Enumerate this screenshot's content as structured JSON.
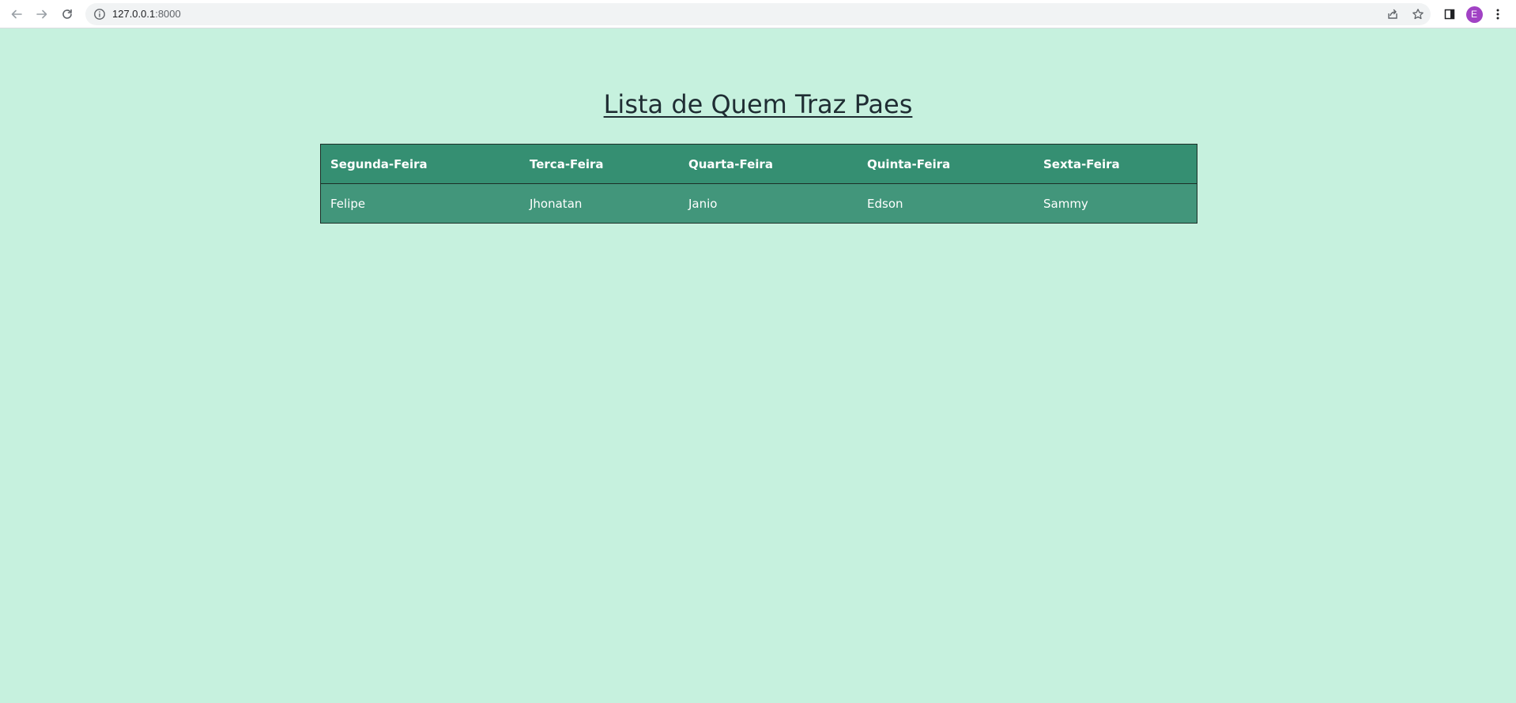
{
  "browser": {
    "url_host": "127.0.0.1",
    "url_port": ":8000",
    "profile_initial": "E",
    "icons": {
      "back": "arrow-left-icon",
      "forward": "arrow-right-icon",
      "reload": "reload-icon",
      "site_info": "info-icon",
      "share": "share-icon",
      "bookmark": "star-icon",
      "side_panel": "side-panel-icon",
      "menu": "kebab-menu-icon"
    }
  },
  "page": {
    "title": "Lista de Quem Traz Paes",
    "background": "#c6f1de",
    "header_bg": "#358f72",
    "row_bg": "#42967b"
  },
  "table": {
    "headers": [
      "Segunda-Feira",
      "Terca-Feira",
      "Quarta-Feira",
      "Quinta-Feira",
      "Sexta-Feira"
    ],
    "rows": [
      [
        "Felipe",
        "Jhonatan",
        "Janio",
        "Edson",
        "Sammy"
      ]
    ]
  }
}
